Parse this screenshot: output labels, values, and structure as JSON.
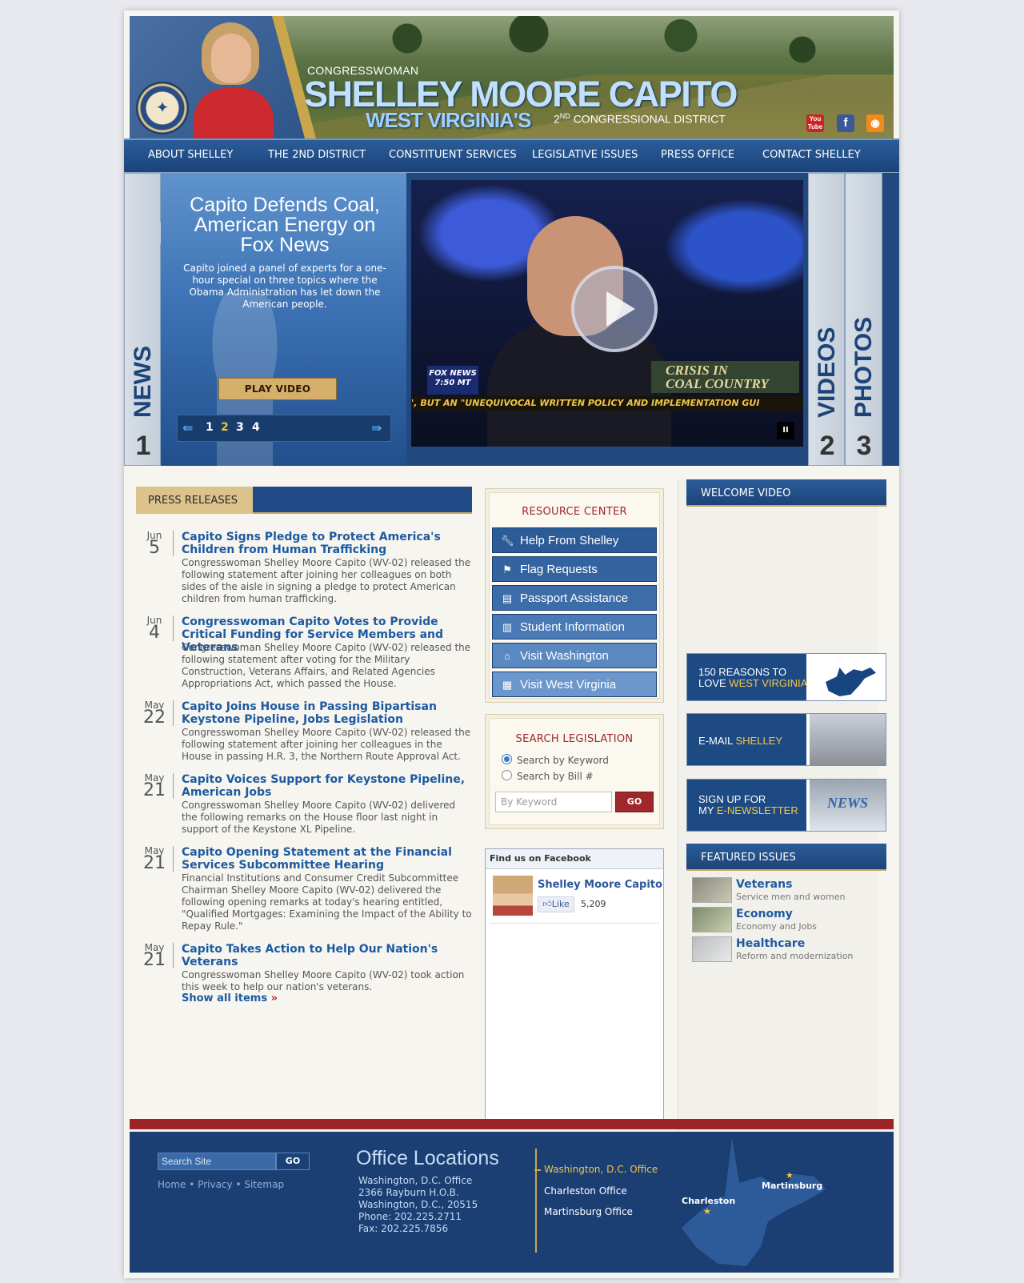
{
  "header": {
    "congresswoman": "CONGRESSWOMAN",
    "name": "SHELLEY MOORE CAPITO",
    "state": "WEST VIRGINIA'S",
    "district_ordinal": "2",
    "district_suffix": "ND",
    "district_label": "CONGRESSIONAL DISTRICT",
    "seal_text": "U.S. HOUSE OF REPRESENTATIVES",
    "social": {
      "youtube": "You Tube",
      "facebook": "f",
      "rss": "rss-icon"
    }
  },
  "nav": [
    "ABOUT SHELLEY",
    "THE 2ND DISTRICT",
    "CONSTITUENT SERVICES",
    "LEGISLATIVE ISSUES",
    "PRESS OFFICE",
    "CONTACT SHELLEY"
  ],
  "hero": {
    "tabs": [
      {
        "label": "NEWS",
        "num": "1"
      },
      {
        "label": "VIDEOS",
        "num": "2"
      },
      {
        "label": "PHOTOS",
        "num": "3"
      }
    ],
    "title": "Capito Defends Coal, American Energy on Fox News",
    "description": "Capito joined a panel of experts for a one-hour special on three topics where the Obama Administration has let down the American people.",
    "play_label": "PLAY VIDEO",
    "pages": [
      "1",
      "2",
      "3",
      "4"
    ],
    "active_page": "2",
    "video": {
      "logo": "FOX NEWS",
      "time": "7:50 MT",
      "banner_line1": "CRISIS IN",
      "banner_line2": "COAL COUNTRY",
      "ticker": "', BUT AN \"UNEQUIVOCAL WRITTEN POLICY AND IMPLEMENTATION GUI",
      "pause": "II"
    }
  },
  "press": {
    "heading": "PRESS RELEASES",
    "items": [
      {
        "month": "Jun",
        "day": "5",
        "title": "Capito Signs Pledge to Protect America's Children from Human Trafficking",
        "body": "Congresswoman Shelley Moore Capito (WV-02) released the following statement after joining her colleagues on both sides of the aisle in signing a pledge to protect American children from human trafficking."
      },
      {
        "month": "Jun",
        "day": "4",
        "title": "Congresswoman Capito Votes to Provide Critical Funding for Service Members and Veterans",
        "body": "Congresswoman Shelley Moore Capito (WV-02) released the following statement after voting for the Military Construction, Veterans Affairs, and Related Agencies Appropriations Act, which passed the House."
      },
      {
        "month": "May",
        "day": "22",
        "title": "Capito Joins House in Passing Bipartisan Keystone Pipeline, Jobs Legislation",
        "body": "Congresswoman Shelley Moore Capito (WV-02) released the following statement after joining her colleagues in the House in passing H.R. 3, the Northern Route Approval Act."
      },
      {
        "month": "May",
        "day": "21",
        "title": "Capito Voices Support for Keystone Pipeline, American Jobs",
        "body": "Congresswoman Shelley Moore Capito (WV-02) delivered the following remarks on the House floor last night in support of the Keystone XL Pipeline."
      },
      {
        "month": "May",
        "day": "21",
        "title": "Capito Opening Statement at the Financial Services Subcommittee Hearing",
        "body": "Financial Institutions and Consumer Credit Subcommittee Chairman Shelley Moore Capito (WV-02) delivered the following opening remarks at today's hearing entitled, \"Qualified Mortgages: Examining the Impact of the Ability to Repay Rule.\""
      },
      {
        "month": "May",
        "day": "21",
        "title": "Capito Takes Action to Help Our Nation's Veterans",
        "body": "Congresswoman Shelley Moore Capito (WV-02) took action this week to help our nation's veterans."
      }
    ],
    "show_all": "Show all items",
    "show_all_arrow": "»"
  },
  "resource_center": {
    "heading": "RESOURCE CENTER",
    "buttons": [
      {
        "label": "Help From Shelley",
        "icon": "wrench-icon",
        "color": "#2b5c98"
      },
      {
        "label": "Flag Requests",
        "icon": "flag-icon",
        "color": "#34649f"
      },
      {
        "label": "Passport Assistance",
        "icon": "passport-icon",
        "color": "#3d6da8"
      },
      {
        "label": "Student Information",
        "icon": "book-icon",
        "color": "#4a7ab5"
      },
      {
        "label": "Visit Washington",
        "icon": "capitol-icon",
        "color": "#5a88c1"
      },
      {
        "label": "Visit West Virginia",
        "icon": "map-icon",
        "color": "#6c97cd"
      }
    ]
  },
  "search_legislation": {
    "heading": "SEARCH LEGISLATION",
    "options": [
      "Search by Keyword",
      "Search by Bill #"
    ],
    "selected": "Search by Keyword",
    "placeholder": "By Keyword",
    "go_label": "GO"
  },
  "facebook": {
    "header": "Find us on Facebook",
    "page_name": "Shelley Moore Capito",
    "like_label": "Like",
    "like_count": "5,209"
  },
  "sidebar": {
    "welcome_video": "WELCOME VIDEO",
    "promos": [
      {
        "line1": "150 REASONS TO",
        "line2_plain": "LOVE ",
        "line2_gold": "WEST VIRGINIA"
      },
      {
        "line1_plain": "E-MAIL ",
        "line1_gold": "SHELLEY"
      },
      {
        "line1": "SIGN UP FOR",
        "line2_plain": "MY ",
        "line2_gold": "E-NEWSLETTER",
        "art": "NEWS"
      }
    ],
    "featured_heading": "FEATURED ISSUES",
    "featured": [
      {
        "name": "Veterans",
        "sub": "Service men and women"
      },
      {
        "name": "Economy",
        "sub": "Economy and Jobs"
      },
      {
        "name": "Healthcare",
        "sub": "Reform and modernization"
      }
    ]
  },
  "footer": {
    "search_placeholder": "Search Site",
    "go_label": "GO",
    "links": [
      "Home",
      "Privacy",
      "Sitemap"
    ],
    "link_sep": "•",
    "office_title": "Office Locations",
    "address": [
      "Washington, D.C. Office",
      "2366 Rayburn H.O.B.",
      "Washington, D.C., 20515",
      "Phone: 202.225.2711",
      "Fax: 202.225.7856"
    ],
    "offices": [
      "Washington, D.C. Office",
      "Charleston Office",
      "Martinsburg Office"
    ],
    "active_office": "Washington, D.C. Office",
    "map_labels": [
      "Charleston",
      "Martinsburg"
    ]
  }
}
